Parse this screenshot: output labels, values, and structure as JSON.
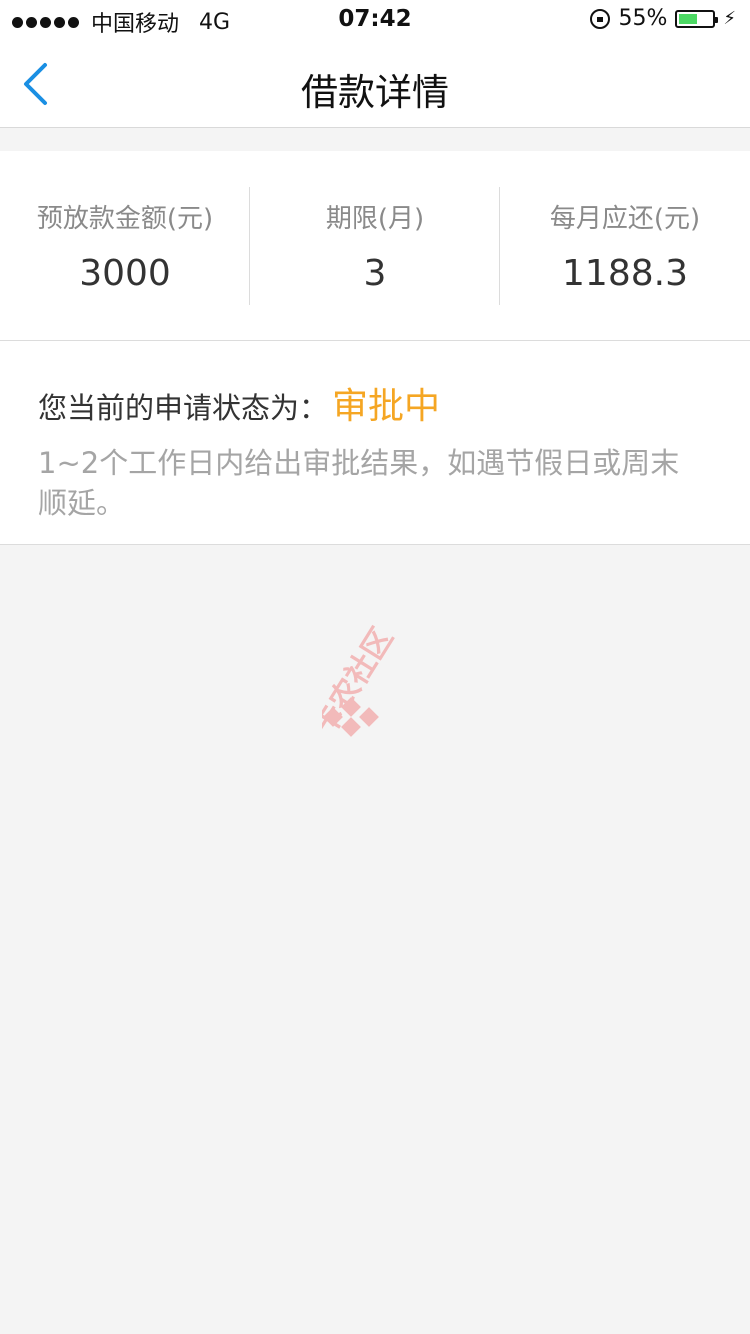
{
  "status_bar": {
    "carrier": "中国移动",
    "network": "4G",
    "time": "07:42",
    "battery_percent": "55%",
    "battery_level": 0.55
  },
  "nav": {
    "title": "借款详情",
    "back_icon": "chevron-left-icon",
    "accent_color": "#1a8fe3"
  },
  "summary": {
    "items": [
      {
        "label": "预放款金额(元)",
        "value": "3000"
      },
      {
        "label": "期限(月)",
        "value": "3"
      },
      {
        "label": "每月应还(元)",
        "value": "1188.3"
      }
    ]
  },
  "application": {
    "status_prefix": "您当前的申请状态为：",
    "status_value": "审批中",
    "status_color": "#f5a623",
    "note": "1~2个工作日内给出审批结果，如遇节假日或周末顺延。"
  },
  "watermark": {
    "text": "卡农社区",
    "color": "#f28b8b"
  }
}
